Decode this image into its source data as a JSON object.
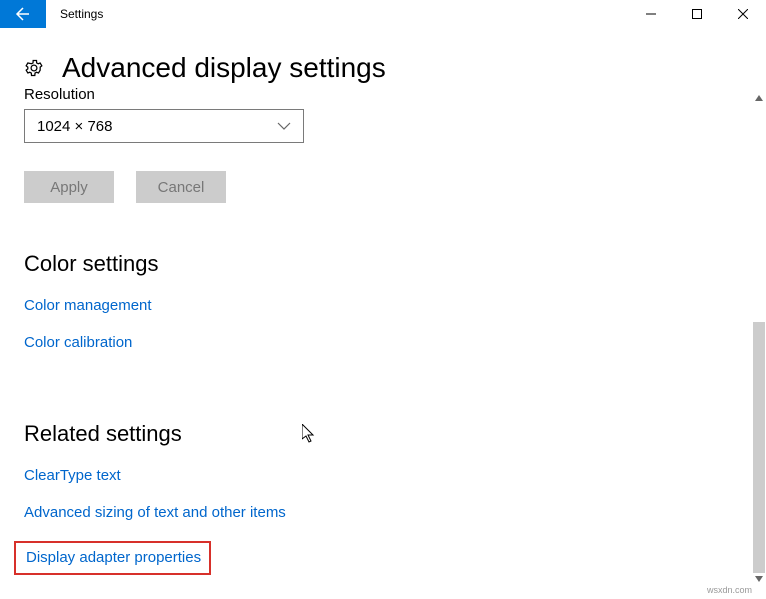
{
  "window": {
    "title": "Settings"
  },
  "header": {
    "title": "Advanced display settings"
  },
  "resolution": {
    "label_truncated": "Resolution",
    "selected": "1024 × 768",
    "apply": "Apply",
    "cancel": "Cancel"
  },
  "color_section": {
    "title": "Color settings",
    "links": {
      "management": "Color management",
      "calibration": "Color calibration"
    }
  },
  "related_section": {
    "title": "Related settings",
    "cleartype": "ClearType text",
    "sizing": "Advanced sizing of text and other items",
    "adapter": "Display adapter properties"
  },
  "footer": {
    "watermark": "wsxdn.com"
  }
}
